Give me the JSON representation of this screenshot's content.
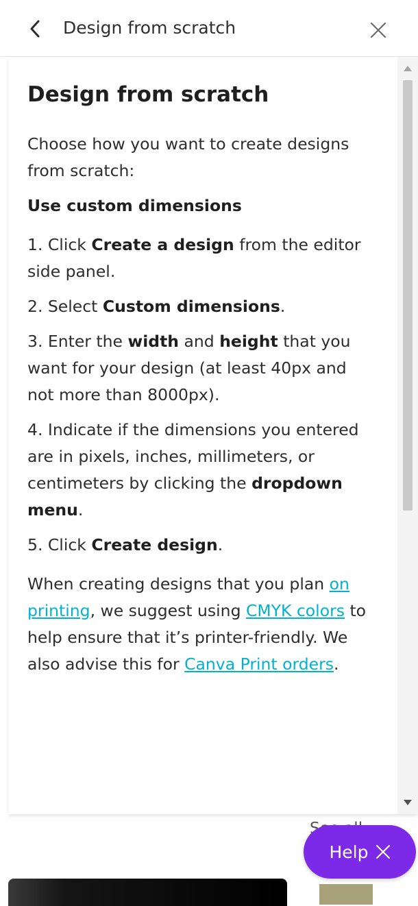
{
  "header": {
    "title": "Design from scratch",
    "back_icon": "chevron-left-icon",
    "close_icon": "close-icon"
  },
  "article": {
    "heading": "Design from scratch",
    "intro": "Choose how you want to create designs from scratch:",
    "subheading": "Use custom dimensions",
    "steps": [
      {
        "pre": "1. Click ",
        "bold": "Create a design",
        "post": " from the editor side panel."
      },
      {
        "pre": "2. Select ",
        "bold": "Custom dimensions",
        "post": "."
      },
      {
        "pre": "3. Enter the ",
        "bold1": "width",
        "mid": " and ",
        "bold2": "height",
        "post": " that you want for your design (at least 40px and not more than 8000px)."
      },
      {
        "pre": "4. Indicate if the dimensions you entered are in pixels, inches, millimeters, or centimeters by clicking the ",
        "bold": "dropdown menu",
        "post": "."
      },
      {
        "pre": "5. Click ",
        "bold": "Create design",
        "post": "."
      }
    ],
    "note": {
      "t1": "When creating designs that you plan ",
      "link1": "on printing",
      "t2": ", we suggest using ",
      "link2": "CMYK colors",
      "t3": " to help ensure that it’s printer-friendly. We also advise this for ",
      "link3": "Canva Print orders",
      "t4": "."
    }
  },
  "background": {
    "see_all_partial": "See all"
  },
  "help_button": {
    "label": "Help",
    "icon": "close-icon"
  },
  "colors": {
    "link": "#00b2d0",
    "help_bg": "#7d2ae8"
  }
}
